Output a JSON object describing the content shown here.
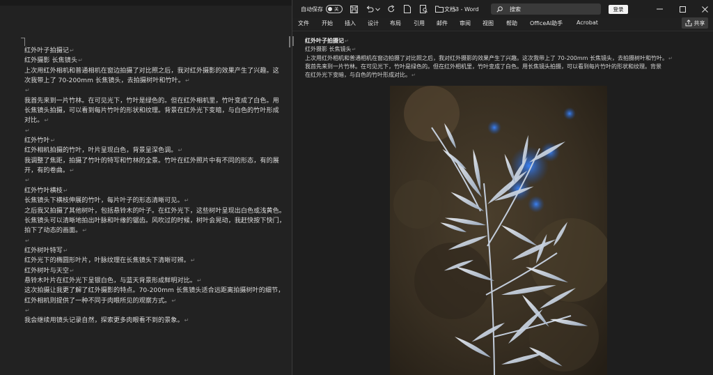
{
  "left_doc": {
    "lines": [
      {
        "text": "红外叶子拍摄记",
        "pilcrow": "↵"
      },
      {
        "text": "红外摄影 长焦镜头",
        "pilcrow": "↵"
      },
      {
        "text": "上次用红外相机和普通相机在窗边拍摄了对比照之后，我对红外摄影的效果产生了兴趣。这",
        "pilcrow": ""
      },
      {
        "text": "次我带上了 70-200mm 长焦镜头，去拍摄树叶和竹叶。",
        "pilcrow": "↵"
      },
      {
        "text": "",
        "pilcrow": "↵"
      },
      {
        "text": "我首先来到一片竹林。在可见光下，竹叶是绿色的。但在红外相机里，竹叶变成了白色。用",
        "pilcrow": ""
      },
      {
        "text": "长焦镜头拍摄，可以看到每片竹叶的形状和纹理。背景在红外光下变暗，与白色的竹叶形成",
        "pilcrow": ""
      },
      {
        "text": "对比。",
        "pilcrow": "↵"
      },
      {
        "text": "",
        "pilcrow": "↵"
      },
      {
        "text": "红外竹叶",
        "pilcrow": "↵"
      },
      {
        "text": "红外相机拍摄的竹叶，叶片呈现白色，背景呈深色调。",
        "pilcrow": "↵"
      },
      {
        "text": "我调整了焦距，拍摄了竹叶的特写和竹林的全景。竹叶在红外照片中有不同的形态，有的展",
        "pilcrow": ""
      },
      {
        "text": "开，有的卷曲。",
        "pilcrow": "↵"
      },
      {
        "text": "",
        "pilcrow": "↵"
      },
      {
        "text": "红外竹叶横枝",
        "pilcrow": "↵"
      },
      {
        "text": "长焦镜头下横枝伸展的竹叶，每片叶子的形态清晰可见。",
        "pilcrow": "↵"
      },
      {
        "text": "之后我又拍摄了其他树叶，包括悬铃木的叶子。在红外光下，这些树叶呈现出白色或浅黄色。",
        "pilcrow": ""
      },
      {
        "text": "长焦镜头可以清晰地拍出叶脉和叶缘的锯齿。风吹过的时候，树叶会晃动，我赶快按下快门，",
        "pilcrow": ""
      },
      {
        "text": "拍下了动态的画面。",
        "pilcrow": "↵"
      },
      {
        "text": "",
        "pilcrow": "↵"
      },
      {
        "text": "红外树叶特写",
        "pilcrow": "↵"
      },
      {
        "text": "红外光下的椭圆形叶片，叶脉纹理在长焦镜头下清晰可辨。",
        "pilcrow": "↵"
      },
      {
        "text": "红外树叶与天空",
        "pilcrow": "↵"
      },
      {
        "text": "悬铃木叶片在红外光下呈银白色，与蓝天背景形成鲜明对比。",
        "pilcrow": "↵"
      },
      {
        "text": "这次拍摄让我更了解了红外摄影的特点。70-200mm 长焦镜头适合远距离拍摄树叶的细节，",
        "pilcrow": ""
      },
      {
        "text": "红外相机则提供了一种不同于肉眼所见的观察方式。",
        "pilcrow": "↵"
      },
      {
        "text": "",
        "pilcrow": "↵"
      },
      {
        "text": "我会继续用镜头记录自然，探索更多肉眼看不到的景象。",
        "pilcrow": "↵"
      }
    ]
  },
  "titlebar": {
    "autosave_label": "自动保存",
    "autosave_state": "关",
    "doc_title": "文档3 - Word",
    "search_placeholder": "搜索",
    "login_label": "登录"
  },
  "ribbon": {
    "tabs": [
      "文件",
      "开始",
      "插入",
      "设计",
      "布局",
      "引用",
      "邮件",
      "审阅",
      "视图",
      "帮助",
      "OfficeAI助手",
      "Acrobat"
    ],
    "share_label": "共享"
  },
  "right_doc": {
    "lines": [
      {
        "text": "红外叶子拍摄记",
        "pilcrow": "↵",
        "bold": true
      },
      {
        "text": "红外摄影 长焦镜头",
        "pilcrow": "↵",
        "bold": false
      },
      {
        "text": "上次用红外相机和普通相机在窗边拍摄了对比照之后，我对红外摄影的效果产生了兴趣。这次我带上了 70-200mm 长焦镜头，去拍摄树叶和竹叶。",
        "pilcrow": "↵",
        "bold": false
      },
      {
        "text": "我首先来到一片竹林。在可见光下，竹叶是绿色的。但在红外相机里，竹叶变成了白色。用长焦镜头拍摄，可以看到每片竹叶的形状和纹理。背景",
        "pilcrow": "",
        "bold": false
      },
      {
        "text": "在红外光下变暗，与白色的竹叶形成对比。",
        "pilcrow": "↵",
        "bold": false
      }
    ]
  },
  "colors": {
    "window_bg": "#202020",
    "doc_bg": "#1e1e1e",
    "text": "#d6d6d6",
    "photo_leaf": "#cfd8e6",
    "photo_bg": "#3a3124",
    "sky_blue": "#2c6fd8"
  },
  "icons": [
    "save-icon",
    "undo-icon",
    "redo-icon",
    "new-doc-icon",
    "print-preview-icon",
    "open-folder-icon",
    "more-icon",
    "search-icon",
    "minimize-icon",
    "maximize-icon",
    "close-icon",
    "share-icon"
  ]
}
